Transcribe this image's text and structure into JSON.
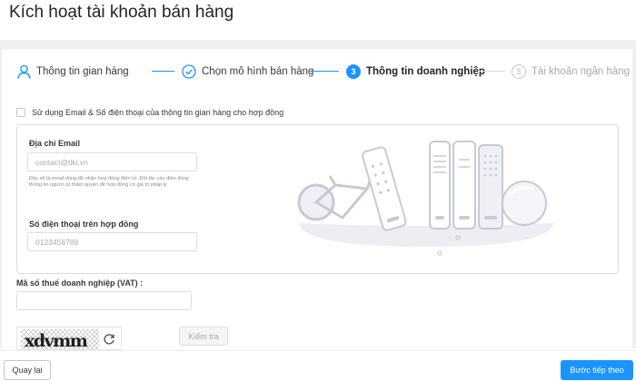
{
  "page": {
    "title": "Kích hoạt tài khoản bán hàng"
  },
  "stepper": {
    "steps": [
      {
        "label": "Thông tin gian hàng",
        "state": "done",
        "icon": "user-icon"
      },
      {
        "label": "Chọn mô hình bán hàng",
        "state": "done",
        "icon": "check-circle-icon"
      },
      {
        "label": "Thông tin doanh nghiệp",
        "state": "active",
        "number": "3"
      },
      {
        "label": "Tài khoản ngân hàng",
        "state": "pending",
        "icon": "dollar-circle-icon"
      }
    ]
  },
  "contract_option": {
    "label": "Sử dụng Email & Số điện thoại của thông tin gian hàng cho hợp đồng",
    "checked": false
  },
  "email": {
    "label": "Địa chỉ Email",
    "placeholder": "contact@tiki.vn",
    "helper": "Đây sẽ là email dùng để nhận hợp đồng điện tử. Đối tác cần điền đúng thông tin người có thẩm quyền để hợp đồng có giá trị pháp lý"
  },
  "phone": {
    "label": "Số điện thoại trên hợp đồng",
    "placeholder": "0123456789"
  },
  "vat": {
    "label": "Mã số thuế doanh nghiệp (VAT) :",
    "value": ""
  },
  "captcha": {
    "text": "xdvmm",
    "check_label": "Kiểm tra",
    "refresh_icon": "refresh-icon"
  },
  "footer": {
    "back_label": "Quay lại",
    "next_label": "Bước tiếp theo"
  },
  "colors": {
    "primary": "#1a94ff",
    "text": "#242424",
    "muted": "#a8a8b0",
    "border": "#dddde3",
    "bg_gray": "#efeff4"
  }
}
